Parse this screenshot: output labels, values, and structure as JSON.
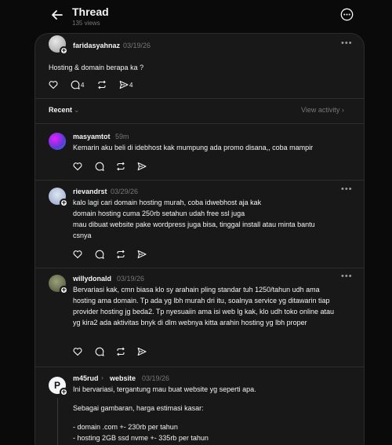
{
  "header": {
    "title": "Thread",
    "views": "135 views"
  },
  "original_post": {
    "username": "faridasyahnaz",
    "date": "03/19/26",
    "text": "Hosting & domain berapa ka ?",
    "reply_count": "4",
    "share_count": "4"
  },
  "sort": {
    "label": "Recent",
    "view_activity": "View activity"
  },
  "replies": [
    {
      "username": "masyamtot",
      "date": "59m",
      "lines": [
        "Kemarin aku beli di idebhost kak mumpung ada promo disana,, coba mampir"
      ]
    },
    {
      "username": "rievandrst",
      "date": "03/29/26",
      "lines": [
        "kalo lagi cari domain hosting murah, coba idwebhost aja kak",
        "domain hosting cuma 250rb setahun udah free ssl juga",
        "mau dibuat website pake wordpress juga bisa, tinggal install atau minta bantu csnya"
      ]
    },
    {
      "username": "willydonald",
      "date": "03/19/26",
      "lines": [
        "Bervariasi kak, cmn biasa klo sy arahain pling standar tuh 1250/tahun udh ama hosting ama domain. Tp ada yg lbh murah dri itu, soalnya service yg ditawarin tiap provider hosting jg beda2. Tp nyesuaiin ama isi web lg kak, klo udh toko online atau yg kira2 ada aktivitas bnyk di dlm webnya kitta arahin hosting yg lbh proper"
      ]
    },
    {
      "username": "m45rud",
      "reply_to": "website",
      "date": "03/19/26",
      "avatar_letter": "P",
      "lines": [
        "Ini bervariasi, tergantung mau buat website yg seperti apa.",
        "Sebagai gambaran, harga estimasi kasar:",
        "- domain .com +- 230rb per tahun",
        "- hosting 2GB ssd nvme +- 335rb per tahun"
      ]
    }
  ],
  "colors": {
    "background": "#0a0a0a",
    "panel": "#181818",
    "border": "#2d2d2d",
    "muted": "#777777"
  },
  "icons": [
    "back-arrow-icon",
    "more-circle-icon",
    "more-dots-icon",
    "heart-icon",
    "comment-icon",
    "repost-icon",
    "share-icon",
    "plus-icon",
    "chevron-right-icon"
  ]
}
